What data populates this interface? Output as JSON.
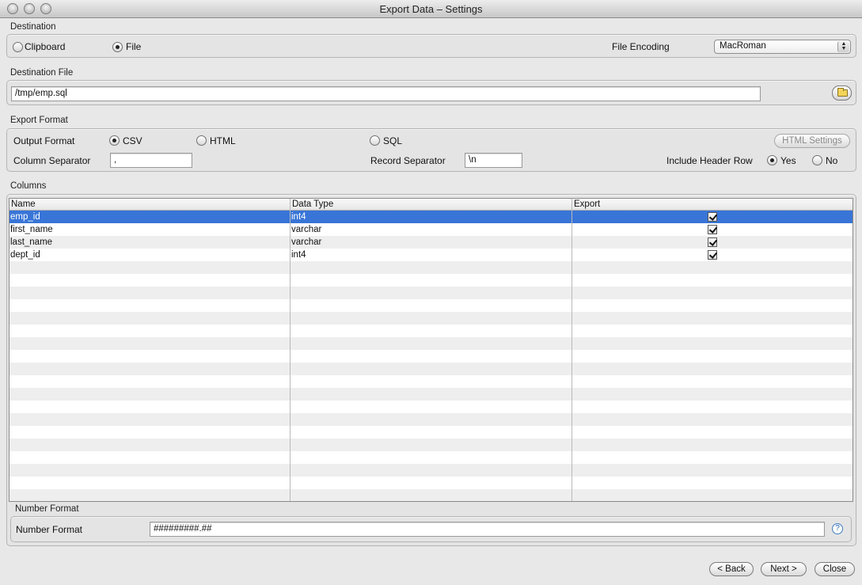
{
  "window": {
    "title": "Export Data – Settings"
  },
  "destination": {
    "group_label": "Destination",
    "clipboard_label": "Clipboard",
    "file_label": "File",
    "selected": "File",
    "encoding_label": "File Encoding",
    "encoding_value": "MacRoman"
  },
  "destination_file": {
    "group_label": "Destination File",
    "path": "/tmp/emp.sql",
    "browse_icon": "folder-icon"
  },
  "export_format": {
    "group_label": "Export Format",
    "output_format_label": "Output Format",
    "options": [
      "CSV",
      "HTML",
      "SQL"
    ],
    "selected": "CSV",
    "html_settings_label": "HTML Settings",
    "column_separator_label": "Column Separator",
    "column_separator_value": ",",
    "record_separator_label": "Record Separator",
    "record_separator_value": "\\n",
    "include_header_label": "Include Header Row",
    "yes_label": "Yes",
    "no_label": "No",
    "include_header_selected": "Yes"
  },
  "columns": {
    "group_label": "Columns",
    "headers": [
      "Name",
      "Data Type",
      "Export"
    ],
    "rows": [
      {
        "name": "emp_id",
        "type": "int4",
        "export": true,
        "selected": true
      },
      {
        "name": "first_name",
        "type": "varchar",
        "export": true,
        "selected": false
      },
      {
        "name": "last_name",
        "type": "varchar",
        "export": true,
        "selected": false
      },
      {
        "name": "dept_id",
        "type": "int4",
        "export": true,
        "selected": false
      }
    ],
    "selection_color": "#3875d7"
  },
  "number_format": {
    "group_label": "Number Format",
    "label": "Number Format",
    "value": "#########.##",
    "help_icon": "help-icon",
    "help_glyph": "?"
  },
  "footer": {
    "back_label": "< Back",
    "next_label": "Next >",
    "close_label": "Close"
  }
}
